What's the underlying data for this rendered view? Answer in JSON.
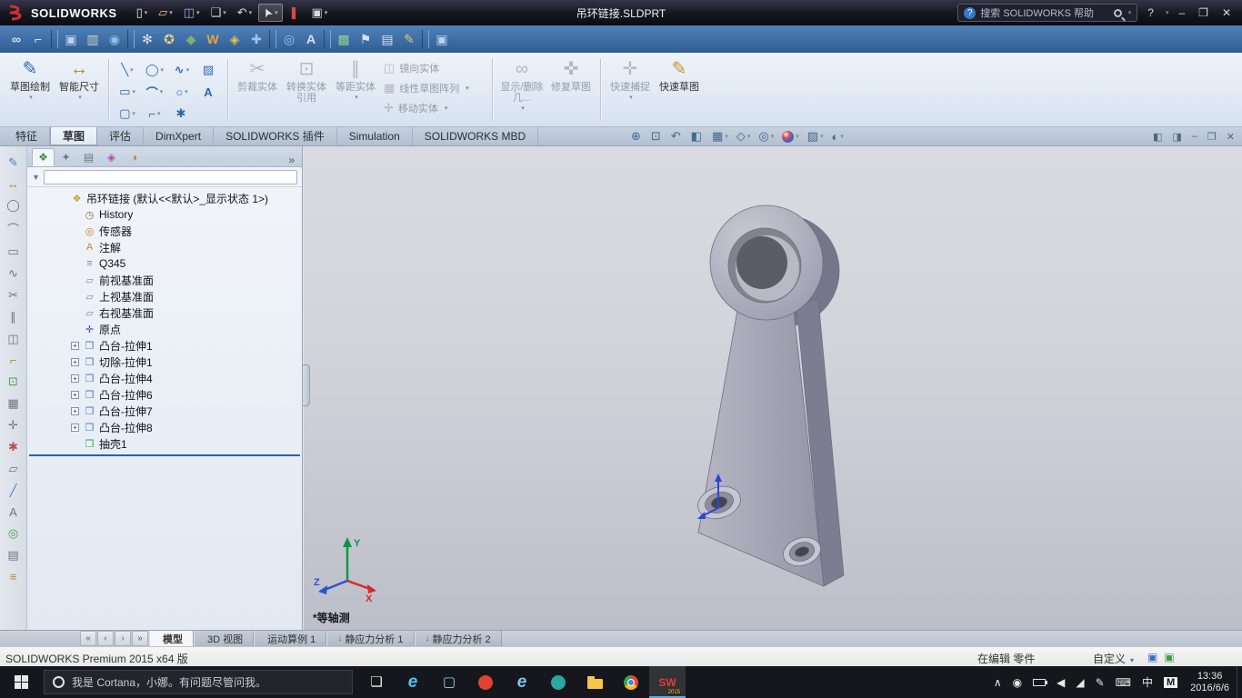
{
  "titlebar": {
    "app_name": "SOLIDWORKS",
    "doc_title": "吊环链接.SLDPRT",
    "search_text": "搜索 SOLIDWORKS 帮助",
    "help_label": "?",
    "minimize_label": "–",
    "restore_label": "❐",
    "close_label": "✕",
    "tools": [
      {
        "name": "new-document-icon",
        "glyph": "▯",
        "color": "#e6e9f2",
        "arrow": "▾"
      },
      {
        "name": "open-document-icon",
        "glyph": "▱",
        "color": "#e8c86a",
        "arrow": "▾"
      },
      {
        "name": "save-icon",
        "glyph": "◫",
        "color": "#8fb8e8",
        "arrow": "▾"
      },
      {
        "name": "print-icon",
        "glyph": "❑",
        "color": "#d5dae6",
        "arrow": "▾"
      },
      {
        "name": "undo-icon",
        "glyph": "↶",
        "color": "#d5dae6",
        "arrow": "▾"
      },
      {
        "name": "select-icon",
        "glyph": "➤",
        "color": "#e6e9f2",
        "arrow": "▾",
        "pressed": true
      },
      {
        "name": "rebuild-icon",
        "glyph": "❚",
        "color": "#d84848"
      },
      {
        "name": "options-icon",
        "glyph": "▣",
        "color": "#d5dae6",
        "arrow": "▾"
      }
    ]
  },
  "toolbar2": {
    "items": [
      {
        "name": "toolbar-icon-link",
        "glyph": "∞",
        "color": "#d9e3f0"
      },
      {
        "name": "toolbar-icon-measure",
        "glyph": "⌐",
        "color": "#d9e3f0"
      },
      {
        "name": "toolbar-separator",
        "inter": "false",
        "sep": true
      },
      {
        "name": "toolbar-icon-monitor",
        "glyph": "▣",
        "color": "#bcd3ec"
      },
      {
        "name": "toolbar-icon-chart",
        "glyph": "▥",
        "color": "#c9d8c9"
      },
      {
        "name": "toolbar-icon-globe",
        "glyph": "◉",
        "color": "#8fc0ea"
      },
      {
        "name": "toolbar-separator",
        "inter": "false",
        "sep": true
      },
      {
        "name": "toolbar-icon-gear",
        "glyph": "✻",
        "color": "#d9e3f0"
      },
      {
        "name": "toolbar-icon-burst",
        "glyph": "✪",
        "color": "#e8d27a"
      },
      {
        "name": "toolbar-icon-shield",
        "glyph": "◆",
        "color": "#7fb069"
      },
      {
        "name": "toolbar-icon-w",
        "glyph": "W",
        "color": "#e8a33d"
      },
      {
        "name": "toolbar-icon-diamond",
        "glyph": "◈",
        "color": "#e3c24d"
      },
      {
        "name": "toolbar-icon-cross",
        "glyph": "✚",
        "color": "#9fc3ea"
      },
      {
        "name": "toolbar-separator",
        "inter": "false",
        "sep": true
      },
      {
        "name": "toolbar-icon-magnifier",
        "glyph": "◎",
        "color": "#9fc3ea"
      },
      {
        "name": "toolbar-icon-text",
        "glyph": "A",
        "color": "#d9e3f0"
      },
      {
        "name": "toolbar-separator",
        "inter": "false",
        "sep": true
      },
      {
        "name": "toolbar-icon-greenbox",
        "glyph": "▩",
        "color": "#8fd08f"
      },
      {
        "name": "toolbar-icon-flag",
        "glyph": "⚑",
        "color": "#d9e3f0"
      },
      {
        "name": "toolbar-icon-sheet",
        "glyph": "▤",
        "color": "#d9e3f0"
      },
      {
        "name": "toolbar-icon-pencil",
        "glyph": "✎",
        "color": "#e8c86a"
      },
      {
        "name": "toolbar-separator",
        "inter": "false",
        "sep": true
      },
      {
        "name": "toolbar-icon-monitor-gear",
        "glyph": "▣",
        "color": "#bcd3ec"
      }
    ]
  },
  "ribbon": {
    "main_buttons": [
      {
        "name": "sketch-button",
        "label": "草图绘制",
        "glyph": "✎",
        "color": "#2f66b8",
        "arrow": "▾"
      },
      {
        "name": "smart-dimension-button",
        "label": "智能尺寸",
        "glyph": "↔",
        "color": "#b8872a",
        "arrow": "▾"
      }
    ],
    "sketch_tools": [
      {
        "name": "line-tool",
        "glyph": "╲",
        "color": "#2f66b8",
        "arrow": "▾"
      },
      {
        "name": "circle-tool",
        "glyph": "◯",
        "color": "#2f66b8",
        "arrow": "▾"
      },
      {
        "name": "spline-tool",
        "glyph": "∿",
        "color": "#2f66b8",
        "arrow": "▾"
      },
      {
        "name": "sketch-picture-tool",
        "glyph": "▨",
        "color": "#2f66b8"
      },
      {
        "name": "rectangle-tool",
        "glyph": "▭",
        "color": "#2f66b8",
        "arrow": "▾"
      },
      {
        "name": "arc-tool",
        "glyph": "⌒",
        "color": "#2f66b8",
        "arrow": "▾"
      },
      {
        "name": "ellipse-tool",
        "glyph": "○",
        "color": "#2f66b8",
        "arrow": "▾"
      },
      {
        "name": "text-tool",
        "glyph": "A",
        "color": "#2f66b8"
      },
      {
        "name": "slot-tool",
        "glyph": "▢",
        "color": "#2f66b8",
        "arrow": "▾"
      },
      {
        "name": "fillet-tool",
        "glyph": "⌐",
        "color": "#2f66b8",
        "arrow": "▾"
      },
      {
        "name": "point-tool",
        "glyph": "✱",
        "color": "#2f66b8"
      }
    ],
    "edit_buttons": [
      {
        "name": "trim-entities-button",
        "label": "剪裁实体",
        "glyph": "✂",
        "color": "#777777",
        "disabled": true
      },
      {
        "name": "convert-entities-button",
        "label": "转换实体引用",
        "glyph": "⊡",
        "color": "#777777",
        "disabled": true
      }
    ],
    "offset_buttons": [
      {
        "name": "offset-entities-button",
        "label": "等距实体",
        "glyph": "∥",
        "color": "#777777",
        "disabled": true,
        "arrow": "▾"
      }
    ],
    "stack_buttons": [
      {
        "name": "mirror-entities-button",
        "label": "镜向实体",
        "glyph": "◫",
        "color": "#777777",
        "disabled": true
      },
      {
        "name": "linear-sketch-pattern-button",
        "label": "线性草图阵列",
        "glyph": "▦",
        "color": "#777777",
        "disabled": true,
        "arrow": "▾"
      },
      {
        "name": "move-entities-button",
        "label": "移动实体",
        "glyph": "✛",
        "color": "#777777",
        "disabled": true,
        "arrow": "▾"
      }
    ],
    "relation_buttons": [
      {
        "name": "display-delete-relations-button",
        "label": "显示/删除几...",
        "glyph": "∞",
        "color": "#777777",
        "disabled": true,
        "arrow": "▾"
      },
      {
        "name": "repair-sketch-button",
        "label": "修复草图",
        "glyph": "✜",
        "color": "#777777",
        "disabled": true
      }
    ],
    "quick_buttons": [
      {
        "name": "quick-snaps-button",
        "label": "快速捕捉",
        "glyph": "✛",
        "color": "#777777",
        "disabled": true,
        "arrow": "▾"
      },
      {
        "name": "rapid-sketch-button",
        "label": "快速草图",
        "glyph": "✎",
        "color": "#c8921e"
      }
    ]
  },
  "tabs": [
    {
      "name": "tab-features",
      "label": "特征"
    },
    {
      "name": "tab-sketch",
      "label": "草图",
      "active": true
    },
    {
      "name": "tab-evaluate",
      "label": "评估"
    },
    {
      "name": "tab-dimxpert",
      "label": "DimXpert"
    },
    {
      "name": "tab-solidworks-addins",
      "label": "SOLIDWORKS 插件"
    },
    {
      "name": "tab-simulation",
      "label": "Simulation"
    },
    {
      "name": "tab-solidworks-mbd",
      "label": "SOLIDWORKS MBD"
    }
  ],
  "headsup": [
    {
      "name": "zoom-fit-icon",
      "glyph": "⊕"
    },
    {
      "name": "zoom-area-icon",
      "glyph": "⊡"
    },
    {
      "name": "previous-view-icon",
      "glyph": "↶"
    },
    {
      "name": "section-view-icon",
      "glyph": "◧"
    },
    {
      "name": "view-orientation-icon",
      "glyph": "▦",
      "arrow": "▾"
    },
    {
      "name": "display-style-icon",
      "glyph": "◇",
      "arrow": "▾"
    },
    {
      "name": "hide-show-items-icon",
      "glyph": "◎",
      "arrow": "▾"
    },
    {
      "name": "edit-appearance-icon",
      "ball": true,
      "arrow": "▾"
    },
    {
      "name": "apply-scene-icon",
      "glyph": "▧",
      "arrow": "▾"
    },
    {
      "name": "view-settings-icon",
      "glyph": "◐",
      "arrow": "▾"
    }
  ],
  "doc_controls": [
    {
      "name": "pane-split-left-icon",
      "glyph": "◧"
    },
    {
      "name": "pane-split-right-icon",
      "glyph": "◨"
    },
    {
      "name": "minimize-doc-icon",
      "glyph": "–"
    },
    {
      "name": "restore-doc-icon",
      "glyph": "❐"
    },
    {
      "name": "close-doc-icon",
      "glyph": "✕"
    }
  ],
  "left_toolbar": [
    {
      "name": "left-tool-sketch",
      "glyph": "✎",
      "color": "#4a78c8"
    },
    {
      "name": "left-tool-dimension",
      "glyph": "↔",
      "color": "#b8872a"
    },
    {
      "name": "left-tool-circle",
      "glyph": "◯",
      "color": "#6a7585"
    },
    {
      "name": "left-tool-arc",
      "glyph": "⌒",
      "color": "#6a7585"
    },
    {
      "name": "left-tool-rectangle",
      "glyph": "▭",
      "color": "#6a7585"
    },
    {
      "name": "left-tool-spline",
      "glyph": "∿",
      "color": "#6a7585"
    },
    {
      "name": "left-tool-trim",
      "glyph": "✂",
      "color": "#6a7585"
    },
    {
      "name": "left-tool-offset",
      "glyph": "∥",
      "color": "#6a7585"
    },
    {
      "name": "left-tool-mirror",
      "glyph": "◫",
      "color": "#6a7585"
    },
    {
      "name": "left-tool-fillet",
      "glyph": "⌐",
      "color": "#b8872a"
    },
    {
      "name": "left-tool-convert",
      "glyph": "⊡",
      "color": "#48a048"
    },
    {
      "name": "left-tool-pattern",
      "glyph": "▦",
      "color": "#6a7585"
    },
    {
      "name": "left-tool-move",
      "glyph": "✛",
      "color": "#6a7585"
    },
    {
      "name": "left-tool-point",
      "glyph": "✱",
      "color": "#c05050"
    },
    {
      "name": "left-tool-plane",
      "glyph": "▱",
      "color": "#6a7585"
    },
    {
      "name": "left-tool-axis",
      "glyph": "╱",
      "color": "#4a78c8"
    },
    {
      "name": "left-tool-text",
      "glyph": "A",
      "color": "#6a7585"
    },
    {
      "name": "left-tool-snap",
      "glyph": "◎",
      "color": "#48a048"
    },
    {
      "name": "left-tool-grid",
      "glyph": "▤",
      "color": "#6a7585"
    },
    {
      "name": "left-tool-measure",
      "glyph": "≡",
      "color": "#b8872a"
    }
  ],
  "panel": {
    "tabs": [
      {
        "name": "featuremanager-tab",
        "glyph": "❖",
        "color": "#3f8f3f",
        "active": true
      },
      {
        "name": "propertymanager-tab",
        "glyph": "✦",
        "color": "#6a7a8c"
      },
      {
        "name": "configurationmanager-tab",
        "glyph": "▤",
        "color": "#6a7a8c"
      },
      {
        "name": "dimxpertmanager-tab",
        "glyph": "◈",
        "color": "#b050b0"
      },
      {
        "name": "displaymanager-tab",
        "glyph": "◑",
        "color": "#d07830"
      }
    ],
    "overflow_chevron": "»",
    "items": [
      {
        "name": "tree-item-root",
        "label": "吊环链接 (默认<<默认>_显示状态 1>)",
        "glyph": "❖",
        "color": "#c8a128",
        "root": true
      },
      {
        "name": "tree-item-history",
        "label": "History",
        "glyph": "◷",
        "color": "#8a6a2a"
      },
      {
        "name": "tree-item-sensors",
        "label": "传感器",
        "glyph": "◎",
        "color": "#d07820"
      },
      {
        "name": "tree-item-annotations",
        "label": "注解",
        "glyph": "A",
        "color": "#c09020"
      },
      {
        "name": "tree-item-material",
        "label": "Q345",
        "glyph": "≡",
        "color": "#7a8aa0"
      },
      {
        "name": "tree-item-front-plane",
        "label": "前视基准面",
        "glyph": "▱",
        "color": "#7a8aa0"
      },
      {
        "name": "tree-item-top-plane",
        "label": "上视基准面",
        "glyph": "▱",
        "color": "#7a8aa0"
      },
      {
        "name": "tree-item-right-plane",
        "label": "右视基准面",
        "glyph": "▱",
        "color": "#7a8aa0"
      },
      {
        "name": "tree-item-origin",
        "label": "原点",
        "glyph": "✛",
        "color": "#3050c0"
      },
      {
        "name": "tree-item-boss-extrude1",
        "label": "凸台-拉伸1",
        "glyph": "❒",
        "color": "#4a78c8",
        "exp": "+"
      },
      {
        "name": "tree-item-cut-extrude1",
        "label": "切除-拉伸1",
        "glyph": "❒",
        "color": "#4a78c8",
        "exp": "+"
      },
      {
        "name": "tree-item-boss-extrude4",
        "label": "凸台-拉伸4",
        "glyph": "❒",
        "color": "#4a78c8",
        "exp": "+"
      },
      {
        "name": "tree-item-boss-extrude6",
        "label": "凸台-拉伸6",
        "glyph": "❒",
        "color": "#4a78c8",
        "exp": "+"
      },
      {
        "name": "tree-item-boss-extrude7",
        "label": "凸台-拉伸7",
        "glyph": "❒",
        "color": "#4a78c8",
        "exp": "+"
      },
      {
        "name": "tree-item-boss-extrude8",
        "label": "凸台-拉伸8",
        "glyph": "❒",
        "color": "#4a78c8",
        "exp": "+"
      },
      {
        "name": "tree-item-shell1",
        "label": "抽壳1",
        "glyph": "❒",
        "color": "#3f9f3f"
      }
    ]
  },
  "graphics": {
    "view_label": "*等轴测",
    "triad": {
      "x": "X",
      "y": "Y",
      "z": "Z"
    }
  },
  "bottom": {
    "nav": [
      {
        "name": "tab-scroll-first",
        "glyph": "«"
      },
      {
        "name": "tab-scroll-prev",
        "glyph": "‹"
      },
      {
        "name": "tab-scroll-next",
        "glyph": "›"
      },
      {
        "name": "tab-scroll-last",
        "glyph": "»"
      }
    ],
    "tabs": [
      {
        "name": "tab-model",
        "label": "模型",
        "active": true
      },
      {
        "name": "tab-3d-views",
        "label": "3D 视图"
      },
      {
        "name": "tab-motion-study-1",
        "label": "运动算例 1"
      },
      {
        "name": "tab-static-1",
        "label": "静应力分析 1",
        "glyph": "↓",
        "color": "#c04040"
      },
      {
        "name": "tab-static-2",
        "label": "静应力分析 2",
        "glyph": "↓",
        "color": "#c04040"
      }
    ]
  },
  "statusbar": {
    "product": "SOLIDWORKS Premium 2015 x64 版",
    "editing": "在编辑 零件",
    "custom": "自定义",
    "indicators": [
      {
        "name": "status-indicator-blue",
        "glyph": "▣",
        "color": "#3a6fc0"
      },
      {
        "name": "status-indicator-green",
        "glyph": "▣",
        "color": "#3f9f3f"
      }
    ]
  },
  "taskbar": {
    "cortana_text": "我是 Cortana，小娜。有问题尽管问我。",
    "time": "13:36",
    "date": "2016/6/6",
    "apps": [
      {
        "name": "task-view-button",
        "glyph": "❏",
        "color": "#e8e8e8"
      },
      {
        "name": "edge-icon",
        "glyph": "e",
        "kind": "edge",
        "color": "#4fc3f7"
      },
      {
        "name": "store-icon",
        "glyph": "▢",
        "color": "#9fd0f0"
      },
      {
        "name": "browser-red-icon",
        "kind": "disc",
        "color": "#e34133"
      },
      {
        "name": "ie-icon",
        "glyph": "e",
        "kind": "edge",
        "color": "#7ec3ef"
      },
      {
        "name": "browser-teal-icon",
        "kind": "disc",
        "color": "#2aa79e"
      },
      {
        "name": "file-explorer-icon",
        "kind": "folder"
      },
      {
        "name": "chrome-icon",
        "kind": "chrome"
      },
      {
        "name": "solidworks-app-icon",
        "kind": "sw",
        "glyph": "SW",
        "color": "#e23c33",
        "sub": "2015",
        "active": true
      }
    ],
    "tray": [
      {
        "name": "hidden-icons-chevron",
        "glyph": "∧"
      },
      {
        "name": "tray-user-icon",
        "glyph": "◉"
      },
      {
        "name": "battery-icon",
        "kind": "battery"
      },
      {
        "name": "volume-icon",
        "glyph": "◀"
      },
      {
        "name": "network-icon",
        "glyph": "◢"
      },
      {
        "name": "pen-icon",
        "glyph": "✎"
      },
      {
        "name": "touch-keyboard-icon",
        "glyph": "⌨"
      },
      {
        "name": "ime-language-indicator",
        "glyph": "中"
      },
      {
        "name": "ime-mode-indicator",
        "glyph": "M",
        "kind": "chip"
      }
    ]
  }
}
